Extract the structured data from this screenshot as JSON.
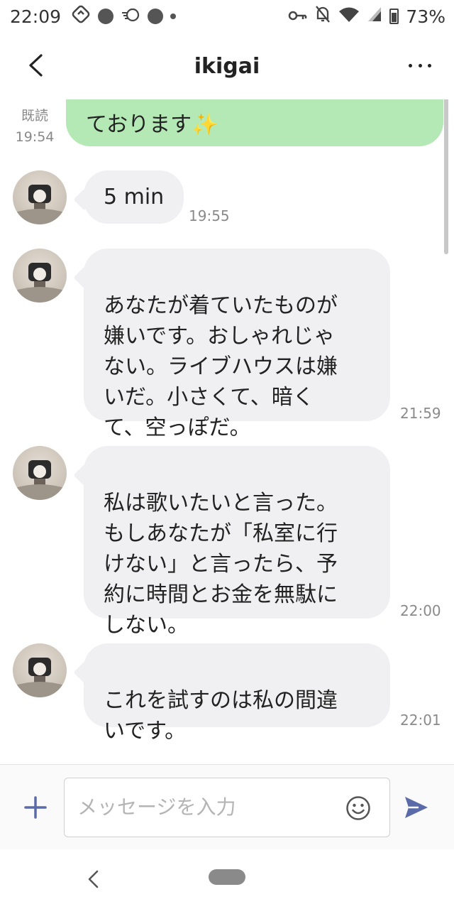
{
  "status_bar": {
    "time": "22:09",
    "battery_percent": "73%"
  },
  "header": {
    "title": "ikigai",
    "back_icon": "chevron-left-icon",
    "menu_icon": "more-horizontal-icon"
  },
  "messages": {
    "sent": {
      "text": "ております✨",
      "read_label": "既読",
      "time": "19:54"
    },
    "received": [
      {
        "text": "5 min",
        "time": "19:55"
      },
      {
        "text": "あなたが着ていたものが\n嫌いです。おしゃれじゃ\nない。ライブハウスは嫌\nいだ。小さくて、暗く\nて、空っぽだ。",
        "time": "21:59"
      },
      {
        "text": "私は歌いたいと言った。\nもしあなたが「私室に行\nけない」と言ったら、予\n約に時間とお金を無駄に\nしない。",
        "time": "22:00"
      },
      {
        "text": "これを試すのは私の間違\nいです。",
        "time": "22:01"
      }
    ]
  },
  "input_bar": {
    "placeholder": "メッセージを入力",
    "plus_icon": "plus-icon",
    "emoji_icon": "smiley-icon",
    "send_icon": "send-icon"
  },
  "colors": {
    "sent_bubble": "#b4e8b5",
    "received_bubble": "#f0f0f2",
    "accent": "#5b6aa8"
  }
}
